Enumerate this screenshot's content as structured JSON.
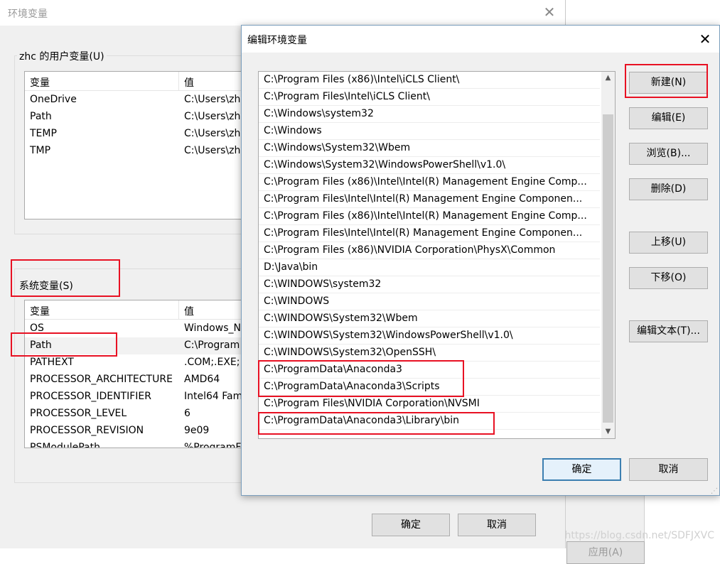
{
  "bg_window": {
    "title": "环境变量",
    "user_group_label": "zhc 的用户变量(U)",
    "sys_group_label": "系统变量(S)",
    "col_var": "变量",
    "col_val": "值",
    "user_vars": [
      {
        "name": "OneDrive",
        "value": "C:\\Users\\zh"
      },
      {
        "name": "Path",
        "value": "C:\\Users\\zh"
      },
      {
        "name": "TEMP",
        "value": "C:\\Users\\zh"
      },
      {
        "name": "TMP",
        "value": "C:\\Users\\zh"
      }
    ],
    "sys_vars": [
      {
        "name": "OS",
        "value": "Windows_N"
      },
      {
        "name": "Path",
        "value": "C:\\Program"
      },
      {
        "name": "PATHEXT",
        "value": ".COM;.EXE;"
      },
      {
        "name": "PROCESSOR_ARCHITECTURE",
        "value": "AMD64"
      },
      {
        "name": "PROCESSOR_IDENTIFIER",
        "value": "Intel64 Fam"
      },
      {
        "name": "PROCESSOR_LEVEL",
        "value": "6"
      },
      {
        "name": "PROCESSOR_REVISION",
        "value": "9e09"
      },
      {
        "name": "PSModulePath",
        "value": "%ProgramF"
      }
    ],
    "ok_label": "确定",
    "cancel_label": "取消",
    "apply_label": "应用(A)"
  },
  "dialog": {
    "title": "编辑环境变量",
    "paths": [
      "C:\\Program Files (x86)\\Intel\\iCLS Client\\",
      "C:\\Program Files\\Intel\\iCLS Client\\",
      "C:\\Windows\\system32",
      "C:\\Windows",
      "C:\\Windows\\System32\\Wbem",
      "C:\\Windows\\System32\\WindowsPowerShell\\v1.0\\",
      "C:\\Program Files (x86)\\Intel\\Intel(R) Management Engine Comp...",
      "C:\\Program Files\\Intel\\Intel(R) Management Engine Componen...",
      "C:\\Program Files (x86)\\Intel\\Intel(R) Management Engine Comp...",
      "C:\\Program Files\\Intel\\Intel(R) Management Engine Componen...",
      "C:\\Program Files (x86)\\NVIDIA Corporation\\PhysX\\Common",
      "D:\\Java\\bin",
      "C:\\WINDOWS\\system32",
      "C:\\WINDOWS",
      "C:\\WINDOWS\\System32\\Wbem",
      "C:\\WINDOWS\\System32\\WindowsPowerShell\\v1.0\\",
      "C:\\WINDOWS\\System32\\OpenSSH\\",
      "C:\\ProgramData\\Anaconda3",
      "C:\\ProgramData\\Anaconda3\\Scripts",
      "C:\\Program Files\\NVIDIA Corporation\\NVSMI",
      "C:\\ProgramData\\Anaconda3\\Library\\bin"
    ],
    "buttons": {
      "new": "新建(N)",
      "edit": "编辑(E)",
      "browse": "浏览(B)...",
      "delete": "删除(D)",
      "move_up": "上移(U)",
      "move_down": "下移(O)",
      "edit_text": "编辑文本(T)...",
      "ok": "确定",
      "cancel": "取消"
    }
  },
  "watermark": "https://blog.csdn.net/SDFJXVC",
  "colors": {
    "highlight": "#e81123",
    "default_button": "#3c7fb1"
  }
}
